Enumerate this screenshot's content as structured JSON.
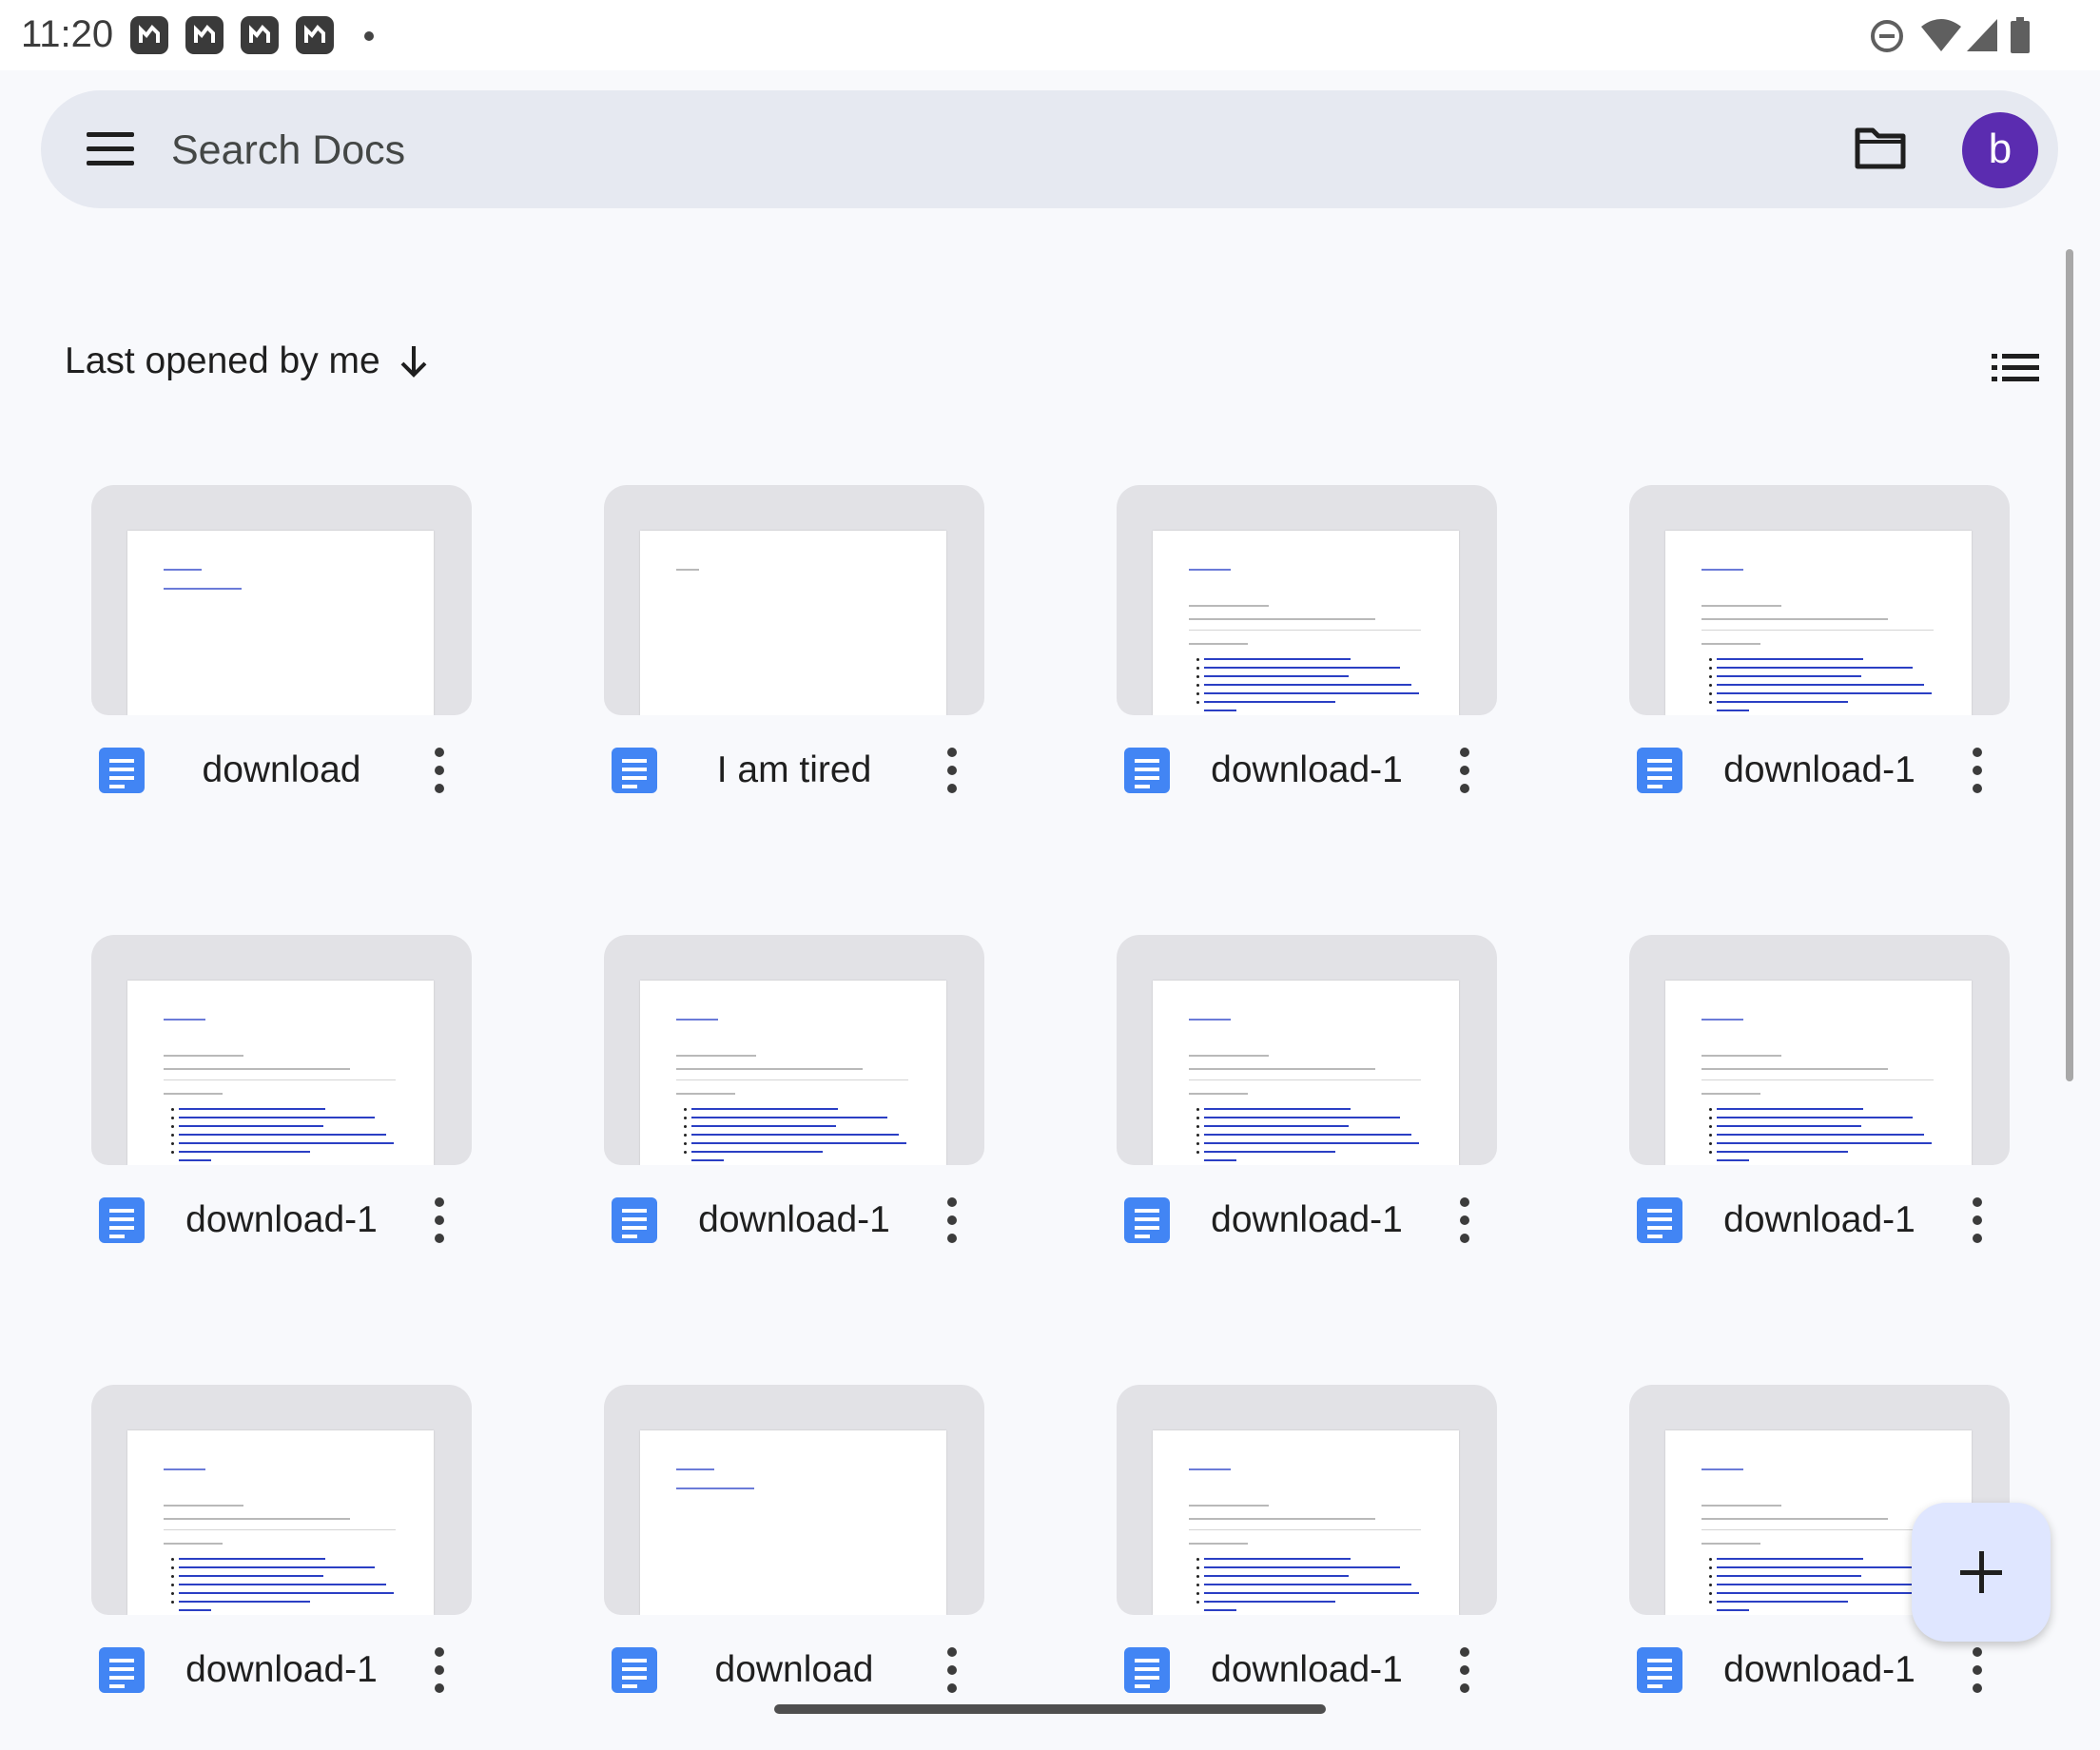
{
  "status_bar": {
    "time": "11:20",
    "notification_icons": [
      "app-notification-icon",
      "app-notification-icon",
      "app-notification-icon",
      "app-notification-icon"
    ],
    "system_icons": [
      "do-not-disturb-icon",
      "wifi-icon",
      "cellular-signal-icon",
      "battery-icon"
    ]
  },
  "search": {
    "placeholder": "Search Docs",
    "value": "",
    "menu_icon": "hamburger-menu-icon",
    "folder_icon": "folder-icon",
    "avatar_letter": "b",
    "avatar_color": "#5b2cb0"
  },
  "sort": {
    "label": "Last opened by me",
    "direction_icon": "arrow-down-icon",
    "view_toggle_icon": "list-view-icon"
  },
  "documents": [
    {
      "title": "download",
      "preview": "short"
    },
    {
      "title": "I am tired",
      "preview": "blank"
    },
    {
      "title": "download-1",
      "preview": "list"
    },
    {
      "title": "download-1",
      "preview": "list"
    },
    {
      "title": "download-1",
      "preview": "list"
    },
    {
      "title": "download-1",
      "preview": "list"
    },
    {
      "title": "download-1",
      "preview": "list"
    },
    {
      "title": "download-1",
      "preview": "list"
    },
    {
      "title": "download-1",
      "preview": "list"
    },
    {
      "title": "download",
      "preview": "short"
    },
    {
      "title": "download-1",
      "preview": "list"
    },
    {
      "title": "download-1",
      "preview": "list"
    }
  ],
  "fab": {
    "icon": "plus-icon"
  },
  "colors": {
    "docs_blue": "#4285f4",
    "search_bar_bg": "#e6e9f1",
    "fab_bg": "#dfe6ff"
  }
}
